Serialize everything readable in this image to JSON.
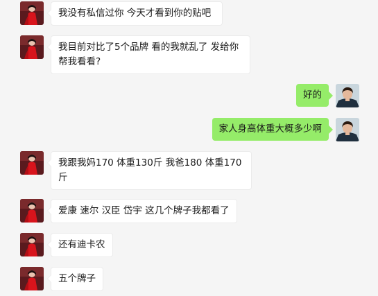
{
  "chat": {
    "messages": [
      {
        "side": "left",
        "avatar": "woman-red-dress-avatar",
        "text": "我没有私信过你 今天才看到你的贴吧"
      },
      {
        "side": "left",
        "avatar": "woman-red-dress-avatar",
        "text": "我目前对比了5个品牌 看的我就乱了 发给你帮我看看?"
      },
      {
        "side": "right",
        "avatar": "man-portrait-avatar",
        "text": "好的"
      },
      {
        "side": "right",
        "avatar": "man-portrait-avatar",
        "text": "家人身高体重大概多少啊"
      },
      {
        "side": "left",
        "avatar": "woman-red-dress-avatar",
        "text": "我跟我妈170  体重130斤 我爸180  体重170斤"
      },
      {
        "side": "left",
        "avatar": "woman-red-dress-avatar",
        "text": "爱康 速尔 汉臣 岱宇 这几个牌子我都看了"
      },
      {
        "side": "left",
        "avatar": "woman-red-dress-avatar",
        "text": "还有迪卡农"
      },
      {
        "side": "left",
        "avatar": "woman-red-dress-avatar",
        "text": "五个牌子"
      }
    ]
  },
  "colors": {
    "background": "#f5f5f5",
    "incoming_bubble": "#ffffff",
    "outgoing_bubble": "#95ec69"
  }
}
